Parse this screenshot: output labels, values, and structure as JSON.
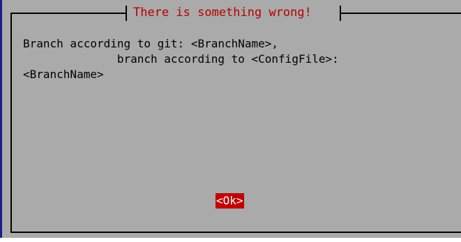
{
  "dialog": {
    "title": "There is something wrong!",
    "message_line_1": "Branch according to git: <BranchName>,",
    "message_line_2": "              branch according to <ConfigFile>:",
    "message_line_3": "<BranchName>",
    "ok_label": "<Ok>"
  },
  "colors": {
    "background": "#aaaaaa",
    "title": "#b50000",
    "button_bg": "#c00000",
    "button_fg": "#ffffff",
    "frame": "#000000"
  }
}
